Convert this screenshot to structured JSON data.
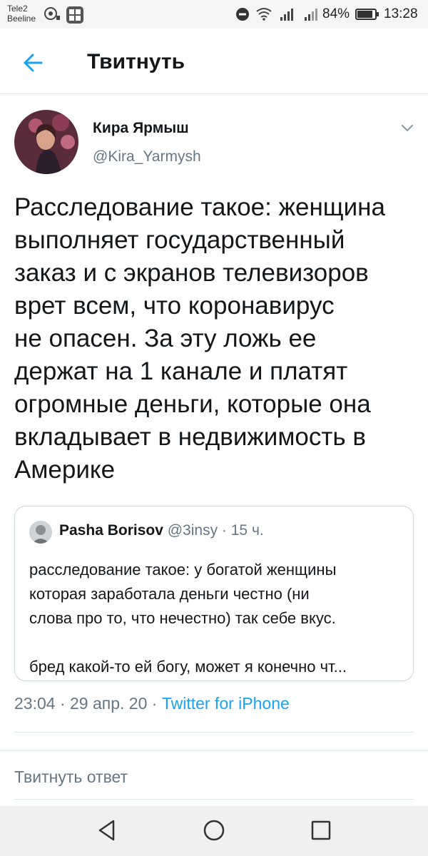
{
  "status_bar": {
    "carrier_1": "Tele2",
    "carrier_2": "Beeline",
    "battery": "84%",
    "time": "13:28"
  },
  "app_bar": {
    "title": "Твитнуть",
    "back_icon": "arrow-left-icon"
  },
  "tweet": {
    "author_name": "Кира Ярмыш",
    "author_handle": "@Kira_Yarmysh",
    "text": "Расследование такое: женщина\nвыполняет государственный\nзаказ и с экранов телевизоров\nврет всем, что коронавирус\nне опасен. За эту ложь ее\nдержат на 1 канале и платят\nогромные деньги, которые она\nвкладывает в недвижимость в\nАмерике",
    "timestamp": "23:04 · 29 апр. 20 · ",
    "source": "Twitter for iPhone"
  },
  "quoted_tweet": {
    "author_name": "Pasha Borisov",
    "meta": " @3insy · 15 ч.",
    "text": "расследование такое: у богатой женщины\nкоторая заработала деньги честно (ни\nслова про то, что нечестно)  так себе вкус.\n\nбред какой-то ей богу, может я конечно чт..."
  },
  "reply": {
    "placeholder": "Твитнуть ответ"
  },
  "colors": {
    "accent": "#1da1f2",
    "secondary_text": "#657786",
    "border": "#ccd6dd"
  }
}
